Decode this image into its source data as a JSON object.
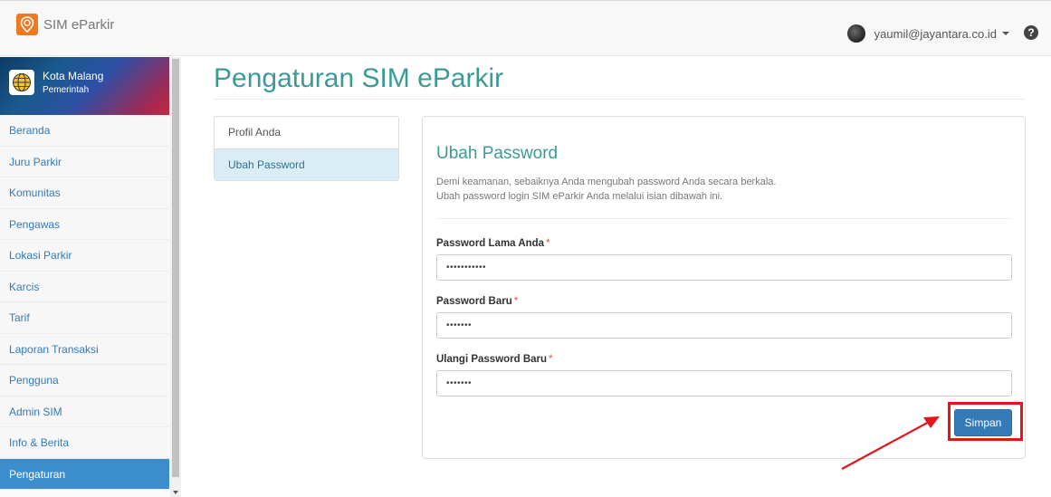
{
  "app": {
    "title": "SIM eParkir"
  },
  "user": {
    "email": "yaumil@jayantara.co.id"
  },
  "sidebar": {
    "org_name": "Kota Malang",
    "org_type": "Pemerintah",
    "items": [
      {
        "label": "Beranda"
      },
      {
        "label": "Juru Parkir"
      },
      {
        "label": "Komunitas"
      },
      {
        "label": "Pengawas"
      },
      {
        "label": "Lokasi Parkir"
      },
      {
        "label": "Karcis"
      },
      {
        "label": "Tarif"
      },
      {
        "label": "Laporan Transaksi"
      },
      {
        "label": "Pengguna"
      },
      {
        "label": "Admin SIM"
      },
      {
        "label": "Info & Berita"
      },
      {
        "label": "Pengaturan"
      }
    ],
    "active_item": "Pengaturan"
  },
  "page": {
    "title": "Pengaturan SIM eParkir"
  },
  "subnav": {
    "items": [
      {
        "label": "Profil Anda"
      },
      {
        "label": "Ubah Password"
      }
    ],
    "active_item": "Ubah Password"
  },
  "form": {
    "heading": "Ubah Password",
    "description_line1": "Demi keamanan, sebaiknya Anda mengubah password Anda secara berkala.",
    "description_line2": "Ubah password login SIM eParkir Anda melalui isian dibawah ini.",
    "required_marker": "*",
    "fields": [
      {
        "label": "Password Lama Anda",
        "value": "•••••••••••"
      },
      {
        "label": "Password Baru",
        "value": "•••••••"
      },
      {
        "label": "Ulangi Password Baru",
        "value": "•••••••"
      }
    ],
    "submit_label": "Simpan"
  },
  "colors": {
    "accent_teal": "#3a9b95",
    "primary_blue": "#337ab7",
    "sidebar_active": "#3c8dcc",
    "annotation_red": "#e3141c",
    "brand_orange": "#f1791d"
  },
  "icons": {
    "brand": "location-pin-icon",
    "org_logo": "globe-emblem-icon",
    "help": "question-circle-icon",
    "user": "avatar-icon"
  }
}
